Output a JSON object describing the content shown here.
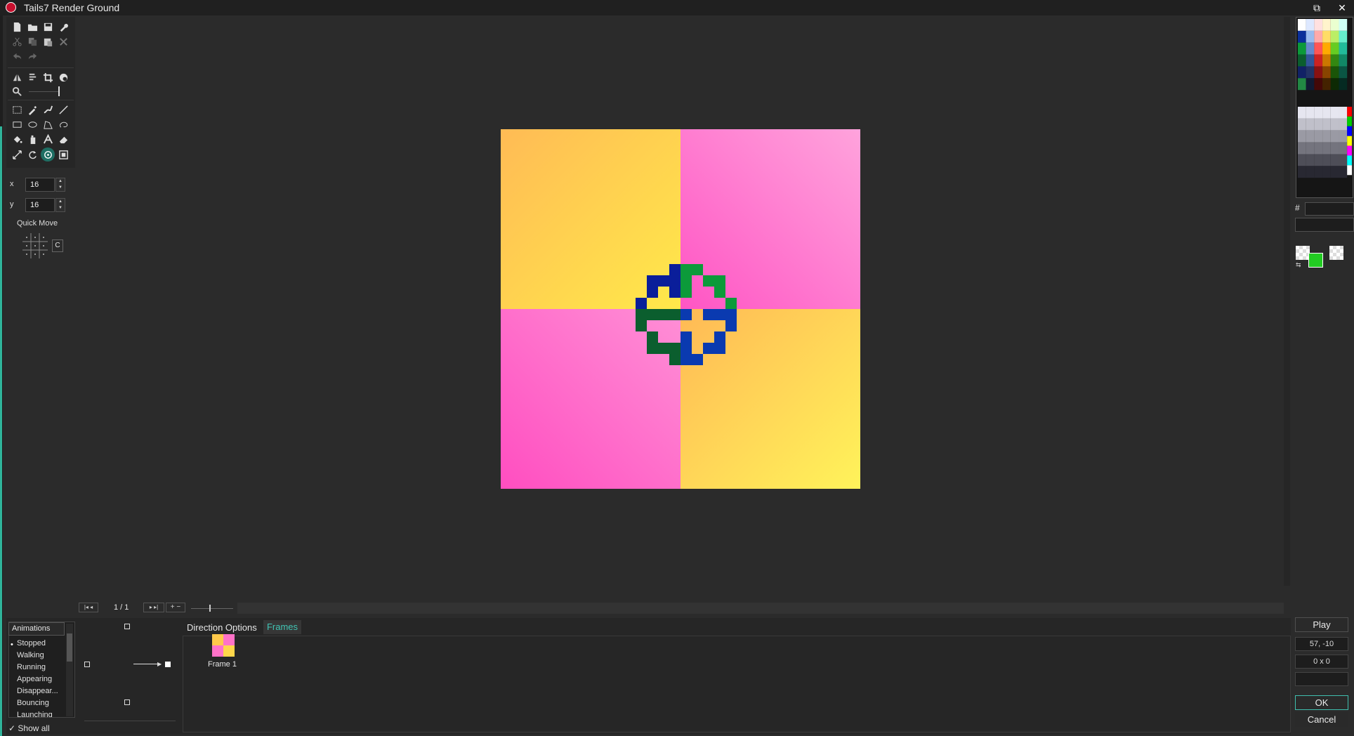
{
  "window": {
    "title": "Tails7 Render Ground",
    "restore_glyph": "⧉",
    "close_glyph": "✕"
  },
  "toolbar": {
    "x_label": "x",
    "x_value": "16",
    "y_label": "y",
    "y_value": "16",
    "quick_move_label": "Quick Move",
    "quick_move_center": "C"
  },
  "timeline": {
    "frame_counter": "1 / 1"
  },
  "animations": {
    "header": "Animations",
    "items": [
      "Stopped",
      "Walking",
      "Running",
      "Appearing",
      "Disappear...",
      "Bouncing",
      "Launching"
    ],
    "selected": "Stopped",
    "show_all_label": "Show all"
  },
  "tabs": {
    "direction_options": "Direction Options",
    "frames": "Frames"
  },
  "frames": [
    {
      "label": "Frame 1"
    }
  ],
  "right_panel": {
    "hex_label": "#",
    "play_label": "Play",
    "coords": "57, -10",
    "size": "0 x 0",
    "ok_label": "OK",
    "cancel_label": "Cancel",
    "primary_color": "#22cc22"
  },
  "colors": {
    "yellow": "#ffd24a",
    "pink": "#ff6ec7",
    "dark_blue": "#0a2f9a",
    "green": "#0c9a3a",
    "dark_green": "#0b5e2e",
    "accent": "#41c4b4"
  }
}
